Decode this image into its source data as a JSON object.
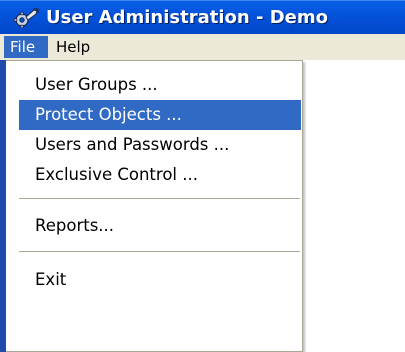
{
  "window": {
    "title": "User Administration - Demo",
    "app_icon": "wrench-gear-icon"
  },
  "menubar": {
    "items": [
      {
        "label": "File",
        "active": true
      },
      {
        "label": "Help",
        "active": false
      }
    ]
  },
  "file_menu": {
    "items": [
      {
        "label": "User Groups ...",
        "selected": false
      },
      {
        "label": "Protect Objects ...",
        "selected": true
      },
      {
        "label": "Users and Passwords ...",
        "selected": false
      },
      {
        "label": "Exclusive Control ...",
        "selected": false
      },
      {
        "label": "Reports...",
        "selected": false
      },
      {
        "label": "Exit",
        "selected": false
      }
    ]
  },
  "colors": {
    "titlebar": "#0553dc",
    "highlight": "#316ac5",
    "menubar": "#ece9d8"
  }
}
